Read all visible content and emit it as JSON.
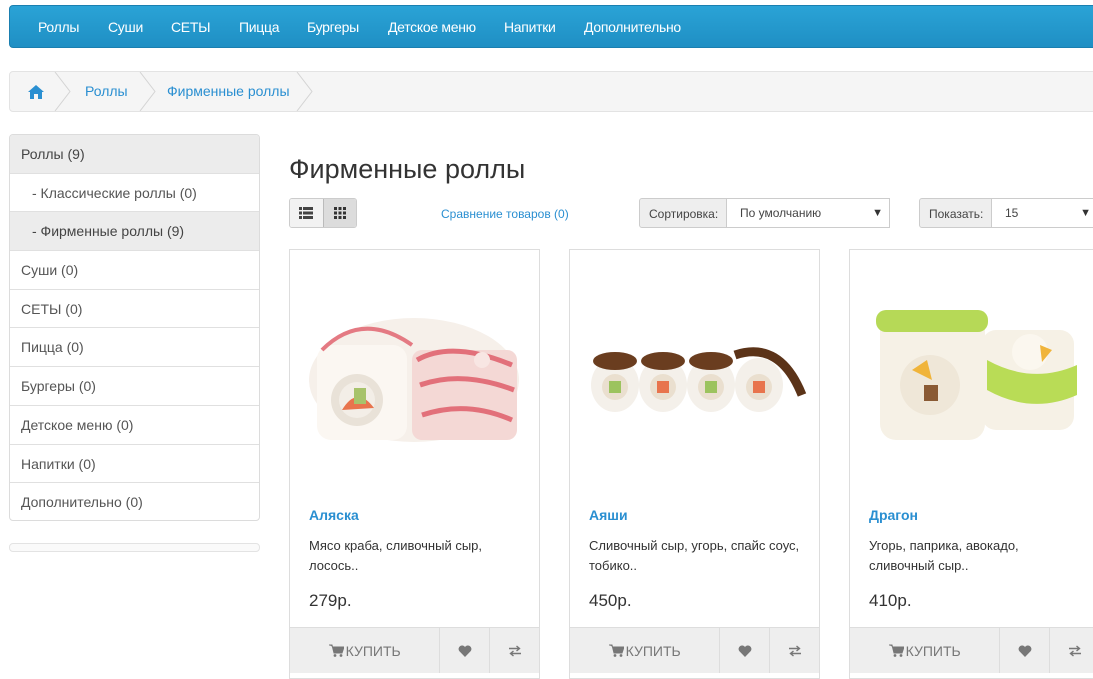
{
  "nav": {
    "items": [
      "Роллы",
      "Суши",
      "СЕТЫ",
      "Пицца",
      "Бургеры",
      "Детское меню",
      "Напитки",
      "Дополнительно"
    ]
  },
  "breadcrumb": {
    "home_icon": "home-icon",
    "items": [
      "Роллы",
      "Фирменные роллы"
    ]
  },
  "sidebar": {
    "items": [
      {
        "label": "Роллы (9)"
      },
      {
        "label": "- Классические роллы (0)"
      },
      {
        "label": "- Фирменные роллы (9)"
      },
      {
        "label": "Суши (0)"
      },
      {
        "label": "СЕТЫ (0)"
      },
      {
        "label": "Пицца (0)"
      },
      {
        "label": "Бургеры (0)"
      },
      {
        "label": "Детское меню (0)"
      },
      {
        "label": "Напитки (0)"
      },
      {
        "label": "Дополнительно (0)"
      }
    ]
  },
  "page": {
    "title": "Фирменные роллы",
    "compare_link": "Сравнение товаров (0)",
    "sort_label": "Сортировка:",
    "sort_value": "По умолчанию",
    "show_label": "Показать:",
    "show_value": "15",
    "view_icons": [
      "list-view-icon",
      "grid-view-icon"
    ]
  },
  "products": [
    {
      "name": "Аляска",
      "desc": "Мясо краба, сливочный сыр, лосось..",
      "price": "279р.",
      "buy_label": "КУПИТЬ",
      "image": "alaska-roll-image"
    },
    {
      "name": "Аяши",
      "desc": "Сливочный сыр, угорь, спайс соус, тобико..",
      "price": "450р.",
      "buy_label": "КУПИТЬ",
      "image": "ayashi-roll-image"
    },
    {
      "name": "Драгон",
      "desc": "Угорь, паприка, авокадо, сливочный сыр..",
      "price": "410р.",
      "buy_label": "КУПИТЬ",
      "image": "dragon-roll-image"
    }
  ],
  "colors": {
    "nav_bg": "#2aa3d6",
    "link": "#2a8fd1",
    "button_bg": "#eeeeee"
  }
}
